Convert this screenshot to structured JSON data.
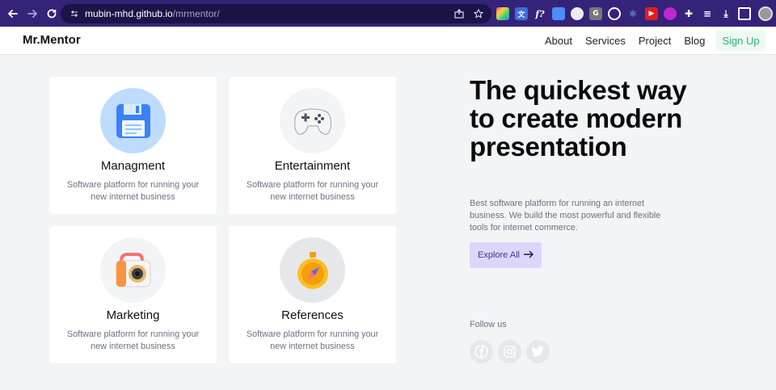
{
  "browser": {
    "url_host": "mubin-mhd.github.io",
    "url_path": "/mrmentor/"
  },
  "header": {
    "logo": "Mr.Mentor",
    "menu": [
      "About",
      "Services",
      "Project",
      "Blog"
    ],
    "signup": "Sign Up"
  },
  "cards": [
    {
      "title": "Managment",
      "desc": "Software platform for running your new internet business",
      "icon": "floppy-disk-icon",
      "bg": "#bfdbfe"
    },
    {
      "title": "Entertainment",
      "desc": "Software platform for running your new internet business",
      "icon": "gamepad-icon",
      "bg": "#f3f4f6"
    },
    {
      "title": "Marketing",
      "desc": "Software platform for running your new internet business",
      "icon": "camera-icon",
      "bg": "#f3f4f6"
    },
    {
      "title": "References",
      "desc": "Software platform for running your new internet business",
      "icon": "compass-icon",
      "bg": "#e5e7eb"
    }
  ],
  "hero": {
    "title": "The quickest way to create modern presentation",
    "description": "Best software platform for running an internet business. We build the most powerful and flexible tools for internet commerce.",
    "cta": "Explore All"
  },
  "follow": {
    "label": "Follow us",
    "icons": [
      "facebook-icon",
      "instagram-icon",
      "twitter-icon"
    ]
  },
  "colors": {
    "browser_bar": "#35237a",
    "accent_green": "#2bb673",
    "cta_bg": "#ddd6fa"
  }
}
